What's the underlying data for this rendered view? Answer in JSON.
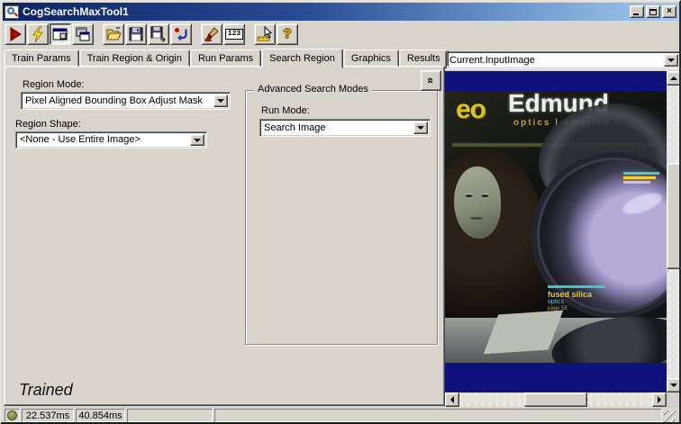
{
  "window": {
    "title": "CogSearchMaxTool1",
    "close_glyph": "×"
  },
  "toolbar": {
    "buttons": [
      "run",
      "electric-run",
      "image-window",
      "floating-window",
      "open-file",
      "save",
      "save-as",
      "reset",
      "graphics-brush",
      "numeric-results",
      "pointer-tool",
      "help"
    ],
    "numeric_badge": "123",
    "help_glyph": "?"
  },
  "tabs": [
    {
      "label": "Train Params"
    },
    {
      "label": "Train Region & Origin"
    },
    {
      "label": "Run Params"
    },
    {
      "label": "Search Region"
    },
    {
      "label": "Graphics"
    },
    {
      "label": "Results"
    }
  ],
  "search_region": {
    "region_mode_label": "Region Mode:",
    "region_mode_value": "Pixel Aligned Bounding Box Adjust Mask",
    "region_shape_label": "Region Shape:",
    "region_shape_value": "<None - Use Entire Image>",
    "advanced_group_title": "Advanced Search Modes",
    "run_mode_label": "Run Mode:",
    "run_mode_value": "Search Image",
    "collapse_glyph": "«",
    "trained_status": "Trained"
  },
  "image_panel": {
    "source_value": "Current.InputImage",
    "cover": {
      "logo": "eo",
      "brand": "Edmund",
      "tagline": "optics | america",
      "promo_title": "fused silica",
      "promo_sub": "optics",
      "promo_page": "page 58"
    }
  },
  "status_bar": {
    "time_1": "22.537ms",
    "time_2": "40.854ms"
  },
  "colors": {
    "navy": "#10107E",
    "titlebar_start": "#0A246A",
    "titlebar_end": "#A6CAF0",
    "indicator_green": "#7F8F3F"
  }
}
